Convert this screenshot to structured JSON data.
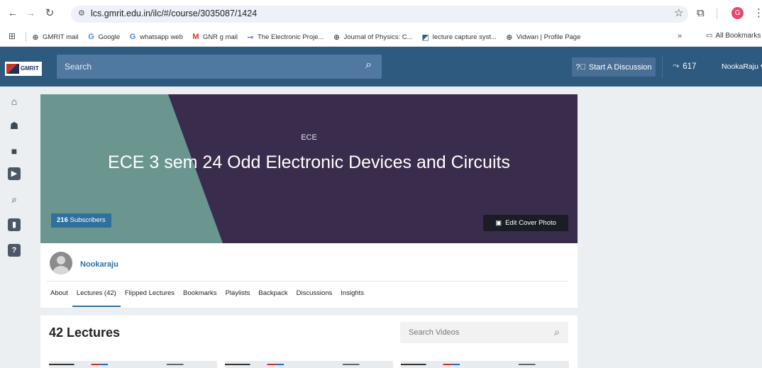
{
  "browser": {
    "url": "lcs.gmrit.edu.in/ilc/#/course/3035087/1424",
    "profile_initial": "G",
    "bookmarks": [
      {
        "label": "GMRIT mail",
        "icon": "globe-icon",
        "glyph": "⊕",
        "color": "#555555"
      },
      {
        "label": "Google",
        "icon": "google-icon",
        "glyph": "G",
        "color": "#4285f4"
      },
      {
        "label": "whatsapp web",
        "icon": "google-icon",
        "glyph": "G",
        "color": "#4285f4"
      },
      {
        "label": "GNR g mail",
        "icon": "gmail-icon",
        "glyph": "M",
        "color": "#d93025"
      },
      {
        "label": "The Electronic Proje...",
        "icon": "link-icon",
        "glyph": "⊸",
        "color": "#6b6bb5"
      },
      {
        "label": "Journal of Physics: C...",
        "icon": "globe-icon",
        "glyph": "⊕",
        "color": "#555555"
      },
      {
        "label": "lecture capture syst...",
        "icon": "app-icon",
        "glyph": "◩",
        "color": "#2e5a80"
      },
      {
        "label": "Vidwan | Profile Page",
        "icon": "globe-icon",
        "glyph": "⊕",
        "color": "#555555"
      }
    ],
    "more": "»",
    "all_bookmarks": "All Bookmarks"
  },
  "header": {
    "logo_text": "GMRIT",
    "search_placeholder": "Search",
    "discussion_button": "Start A Discussion",
    "points": "617",
    "user": "NookaRaju"
  },
  "rail": [
    {
      "name": "home-icon",
      "glyph": "⌂"
    },
    {
      "name": "classroom-icon",
      "glyph": "☗"
    },
    {
      "name": "folder-icon",
      "glyph": "■"
    },
    {
      "name": "video-library-icon",
      "glyph": "▶"
    },
    {
      "name": "search-icon",
      "glyph": "⌕"
    },
    {
      "name": "analytics-icon",
      "glyph": "▮"
    },
    {
      "name": "help-icon",
      "glyph": "?"
    }
  ],
  "course": {
    "code": "ECE",
    "title": "ECE 3 sem 24 Odd Electronic Devices and Circuits",
    "subscribers_count": "216",
    "subscribers_label": "Subscribers",
    "edit_cover": "Edit Cover Photo",
    "owner": "Nookaraju"
  },
  "tabs": [
    {
      "label": "About",
      "active": false
    },
    {
      "label": "Lectures (42)",
      "active": true
    },
    {
      "label": "Flipped Lectures",
      "active": false
    },
    {
      "label": "Bookmarks",
      "active": false
    },
    {
      "label": "Playlists",
      "active": false
    },
    {
      "label": "Backpack",
      "active": false
    },
    {
      "label": "Discussions",
      "active": false
    },
    {
      "label": "Insights",
      "active": false
    }
  ],
  "lectures": {
    "heading": "42 Lectures",
    "search_placeholder": "Search Videos"
  }
}
